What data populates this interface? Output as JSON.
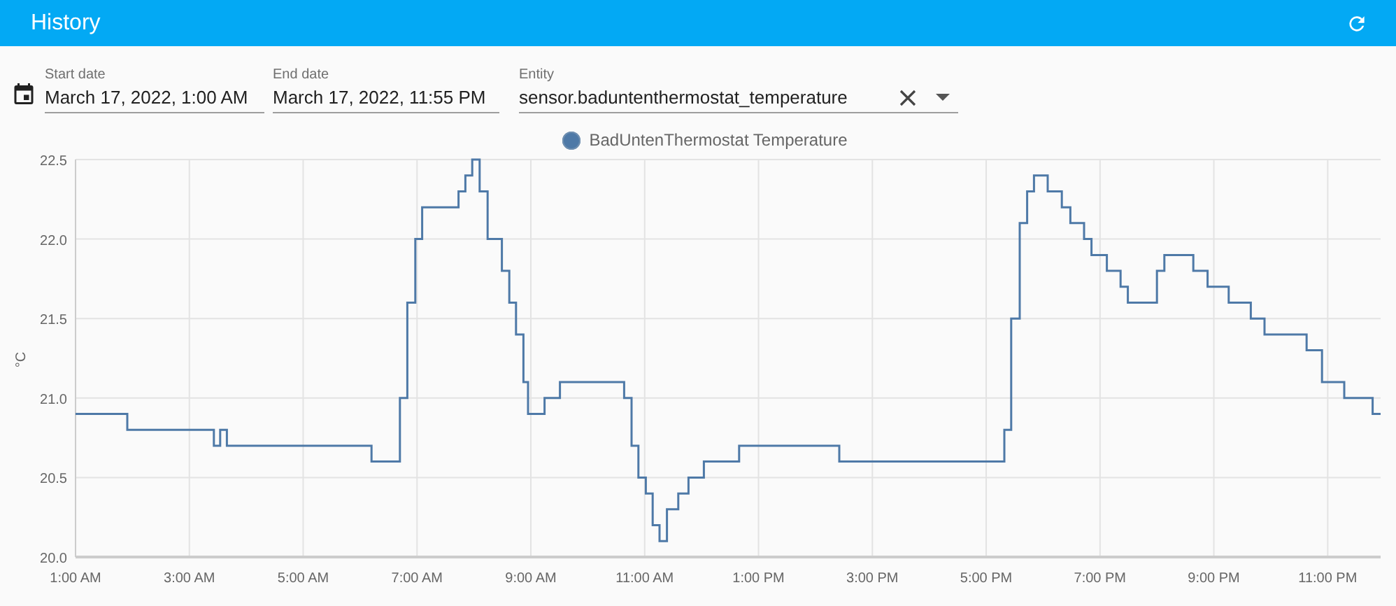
{
  "app_bar": {
    "title": "History"
  },
  "filters": {
    "start_date": {
      "label": "Start date",
      "value": "March 17, 2022, 1:00 AM"
    },
    "end_date": {
      "label": "End date",
      "value": "March 17, 2022, 11:55 PM"
    },
    "entity": {
      "label": "Entity",
      "value": "sensor.baduntenthermostat_temperature"
    }
  },
  "chart": {
    "chart_data": {
      "type": "line",
      "ylabel": "°C",
      "grid": true,
      "x": [
        1,
        1.91,
        1.91,
        3.43,
        3.43,
        3.54,
        3.54,
        3.66,
        3.66,
        6.2,
        6.2,
        6.7,
        6.7,
        6.83,
        6.83,
        6.97,
        6.97,
        7.09,
        7.09,
        7.73,
        7.73,
        7.85,
        7.85,
        7.97,
        7.97,
        8.1,
        8.1,
        8.24,
        8.24,
        8.49,
        8.49,
        8.62,
        8.62,
        8.74,
        8.74,
        8.87,
        8.87,
        8.95,
        8.95,
        9.24,
        9.24,
        9.51,
        9.51,
        10.64,
        10.64,
        10.77,
        10.77,
        10.89,
        10.89,
        11.02,
        11.02,
        11.14,
        11.14,
        11.26,
        11.26,
        11.39,
        11.39,
        11.59,
        11.59,
        11.77,
        11.77,
        12.04,
        12.04,
        12.66,
        12.66,
        14.42,
        14.42,
        17.32,
        17.32,
        17.44,
        17.44,
        17.59,
        17.59,
        17.72,
        17.72,
        17.84,
        17.84,
        18.08,
        18.08,
        18.33,
        18.33,
        18.48,
        18.48,
        18.72,
        18.72,
        18.85,
        18.85,
        19.12,
        19.12,
        19.36,
        19.36,
        19.49,
        19.49,
        20.0,
        20.0,
        20.13,
        20.13,
        20.64,
        20.64,
        20.89,
        20.89,
        21.26,
        21.26,
        21.65,
        21.65,
        21.89,
        21.89,
        22.63,
        22.63,
        22.9,
        22.9,
        23.29,
        23.29,
        23.79,
        23.79,
        23.93
      ],
      "series": [
        {
          "name": "BadUntenThermostat Temperature",
          "color": "#4e79a7",
          "values": [
            20.9,
            20.9,
            20.8,
            20.8,
            20.7,
            20.7,
            20.8,
            20.8,
            20.7,
            20.7,
            20.6,
            20.6,
            21.0,
            21.0,
            21.6,
            21.6,
            22.0,
            22.0,
            22.2,
            22.2,
            22.3,
            22.3,
            22.4,
            22.4,
            22.5,
            22.5,
            22.3,
            22.3,
            22.0,
            22.0,
            21.8,
            21.8,
            21.6,
            21.6,
            21.4,
            21.4,
            21.1,
            21.1,
            20.9,
            20.9,
            21.0,
            21.0,
            21.1,
            21.1,
            21.0,
            21.0,
            20.7,
            20.7,
            20.5,
            20.5,
            20.4,
            20.4,
            20.2,
            20.2,
            20.1,
            20.1,
            20.3,
            20.3,
            20.4,
            20.4,
            20.5,
            20.5,
            20.6,
            20.6,
            20.7,
            20.7,
            20.6,
            20.6,
            20.8,
            20.8,
            21.5,
            21.5,
            22.1,
            22.1,
            22.3,
            22.3,
            22.4,
            22.4,
            22.3,
            22.3,
            22.2,
            22.2,
            22.1,
            22.1,
            22.0,
            22.0,
            21.9,
            21.9,
            21.8,
            21.8,
            21.7,
            21.7,
            21.6,
            21.6,
            21.8,
            21.8,
            21.9,
            21.9,
            21.8,
            21.8,
            21.7,
            21.7,
            21.6,
            21.6,
            21.5,
            21.5,
            21.4,
            21.4,
            21.3,
            21.3,
            21.1,
            21.1,
            21.0,
            21.0,
            20.9,
            20.9
          ]
        }
      ],
      "xlim": [
        1,
        23.93
      ],
      "ylim": [
        20,
        22.5
      ],
      "xticks": [
        {
          "value": 1,
          "label": "1:00 AM"
        },
        {
          "value": 3,
          "label": "3:00 AM"
        },
        {
          "value": 5,
          "label": "5:00 AM"
        },
        {
          "value": 7,
          "label": "7:00 AM"
        },
        {
          "value": 9,
          "label": "9:00 AM"
        },
        {
          "value": 11,
          "label": "11:00 AM"
        },
        {
          "value": 13,
          "label": "1:00 PM"
        },
        {
          "value": 15,
          "label": "3:00 PM"
        },
        {
          "value": 17,
          "label": "5:00 PM"
        },
        {
          "value": 19,
          "label": "7:00 PM"
        },
        {
          "value": 21,
          "label": "9:00 PM"
        },
        {
          "value": 23,
          "label": "11:00 PM"
        }
      ],
      "yticks": [
        {
          "value": 20,
          "label": "20.0"
        },
        {
          "value": 20.5,
          "label": "20.5"
        },
        {
          "value": 21,
          "label": "21.0"
        },
        {
          "value": 21.5,
          "label": "21.5"
        },
        {
          "value": 22,
          "label": "22.0"
        },
        {
          "value": 22.5,
          "label": "22.5"
        }
      ]
    }
  }
}
